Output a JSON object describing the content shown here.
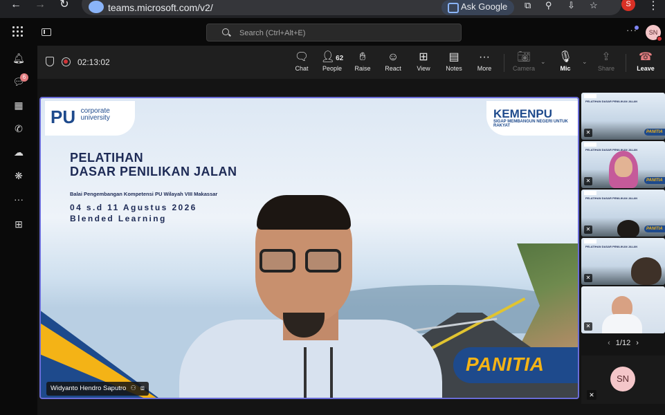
{
  "browser": {
    "url": "teams.microsoft.com/v2/",
    "ask_google": "Ask Google",
    "profile_letter": "S"
  },
  "teams": {
    "search_placeholder": "Search (Ctrl+Alt+E)",
    "user_initials": "SN",
    "chat_badge": "6"
  },
  "meeting": {
    "timer": "02:13:02",
    "controls": {
      "chat": "Chat",
      "people": "People",
      "people_count": "62",
      "raise": "Raise",
      "react": "React",
      "view": "View",
      "notes": "Notes",
      "more": "More",
      "camera": "Camera",
      "mic": "Mic",
      "share": "Share",
      "leave": "Leave"
    }
  },
  "slide": {
    "logo_left_main": "PU",
    "logo_left_sub1": "corporate",
    "logo_left_sub2": "university",
    "logo_right_main": "KEMENPU",
    "logo_right_tagline": "SIGAP MEMBANGUN NEGERI UNTUK RAKYAT",
    "title_line1": "PELATIHAN",
    "title_line2": "DASAR PENILIKAN JALAN",
    "organizer": "Balai Pengembangan Kompetensi PU Wilayah VIII Makassar",
    "dates": "04 s.d 11 Agustus 2026",
    "mode": "Blended Learning",
    "panitia": "PANITIA"
  },
  "presenter": {
    "name": "Widyanto Hendro Saputro"
  },
  "gallery": {
    "page": "1/12",
    "thumb_title": "PELATIHAN DASAR PENILIKAN JALAN",
    "thumb_panitia": "PANITIA"
  },
  "colors": {
    "accent": "#6a6cd8",
    "leave_red": "#e37d80",
    "pu_blue": "#1e4a8c",
    "pu_yellow": "#f4b316"
  }
}
